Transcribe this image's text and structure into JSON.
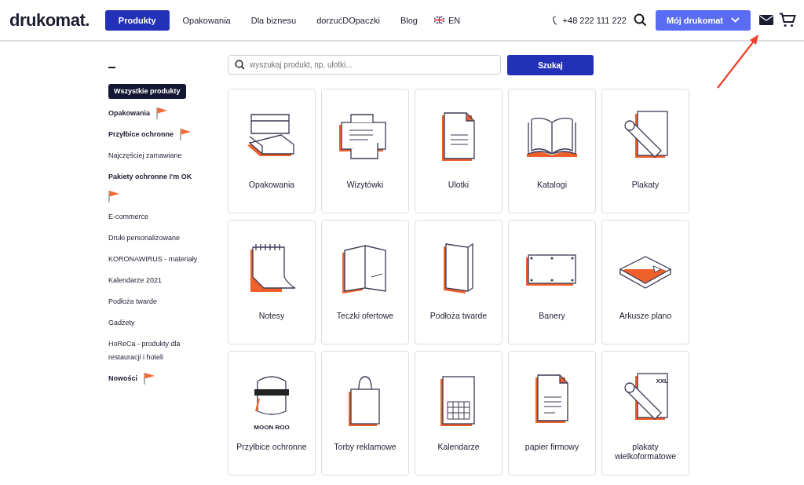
{
  "header": {
    "logo": "drukomat.",
    "nav": [
      {
        "label": "Produkty",
        "selected": true
      },
      {
        "label": "Opakowania",
        "selected": false
      },
      {
        "label": "Dla biznesu",
        "selected": false
      },
      {
        "label": "dorzućDOpaczki",
        "selected": false
      },
      {
        "label": "Blog",
        "selected": false
      }
    ],
    "language": "EN",
    "phone": "+48 222 111 222",
    "account_button": "Mój drukomat"
  },
  "search": {
    "placeholder": "wyszukaj produkt, np. ulotki...",
    "button": "Szukaj"
  },
  "sidebar": {
    "items": [
      {
        "label": "Wszystkie produkty",
        "selected": true,
        "flag": false
      },
      {
        "label": "Opakowania",
        "selected": false,
        "flag": true
      },
      {
        "label": "Przyłbice ochronne",
        "selected": false,
        "flag": true
      },
      {
        "label": "Najczęściej zamawiane",
        "selected": false,
        "flag": false
      },
      {
        "label": "Pakiety ochronne I'm OK",
        "selected": false,
        "flag": true
      },
      {
        "label": "E-commerce",
        "selected": false,
        "flag": false
      },
      {
        "label": "Druki personalizowane",
        "selected": false,
        "flag": false
      },
      {
        "label": "KORONAWIRUS - materiały",
        "selected": false,
        "flag": false
      },
      {
        "label": "Kalendarze 2021",
        "selected": false,
        "flag": false
      },
      {
        "label": "Podłoża twarde",
        "selected": false,
        "flag": false
      },
      {
        "label": "Gadżety",
        "selected": false,
        "flag": false
      },
      {
        "label": "HoReCa - produkty dla restauracji i hoteli",
        "selected": false,
        "flag": false
      },
      {
        "label": "Nowości",
        "selected": false,
        "flag": true
      }
    ]
  },
  "products": [
    {
      "label": "Opakowania"
    },
    {
      "label": "Wizytówki"
    },
    {
      "label": "Ulotki"
    },
    {
      "label": "Katalogi"
    },
    {
      "label": "Plakaty"
    },
    {
      "label": "Notesy"
    },
    {
      "label": "Teczki ofertowe"
    },
    {
      "label": "Podłoża twarde"
    },
    {
      "label": "Banery"
    },
    {
      "label": "Arkusze plano"
    },
    {
      "label": "Przyłbice ochronne",
      "badge": "MOON ROO"
    },
    {
      "label": "Torby reklamowe"
    },
    {
      "label": "Kalendarze"
    },
    {
      "label": "papier firmowy"
    },
    {
      "label": "plakaty wielkoformatowe",
      "badge": "XXL"
    }
  ]
}
